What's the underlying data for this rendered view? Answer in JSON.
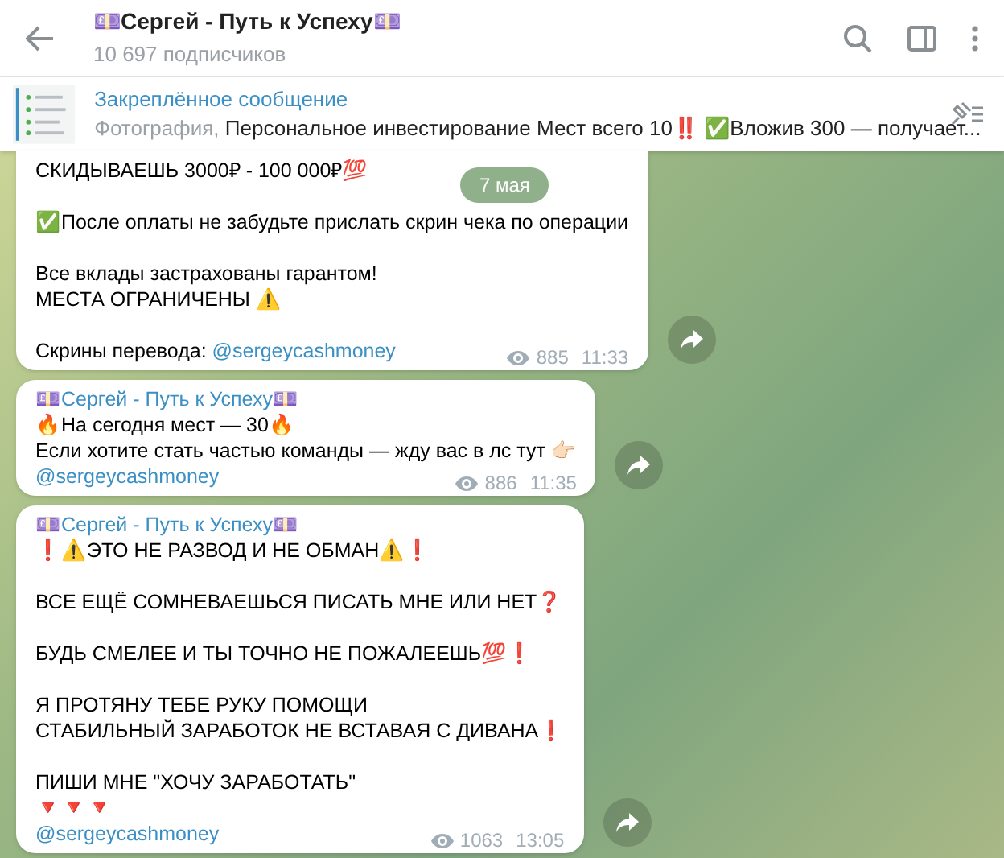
{
  "header": {
    "title": "💷Сергей - Путь к Успеху💷",
    "subtitle": "10 697 подписчиков"
  },
  "pinned": {
    "label": "Закреплённое сообщение",
    "media": "Фотография,",
    "text": "Персональное инвестирование Мест всего 10‼️ ✅Вложив 300 — получает..."
  },
  "date_pill": "7 мая",
  "messages": [
    {
      "paragraphs": [
        [
          "СКИДЫВАЕШЬ 3000₽ - 100 000₽💯"
        ],
        [
          "✅После оплаты не забудьте прислать скрин чека по операции"
        ],
        [
          "Все вклады застрахованы гарантом!",
          "МЕСТА ОГРАНИЧЕНЫ ⚠️"
        ]
      ],
      "link_prefix": "Скрины перевода:",
      "link": "@sergeycashmoney",
      "views": "885",
      "time": "11:33"
    },
    {
      "author": "💷Сергей - Путь к Успеху💷",
      "paragraphs": [
        [
          "🔥На сегодня мест — 30🔥",
          "Если хотите стать частью команды — жду вас в лс тут 👉🏻"
        ]
      ],
      "link": "@sergeycashmoney",
      "views": "886",
      "time": "11:35"
    },
    {
      "author": "💷Сергей - Путь к Успеху💷",
      "paragraphs": [
        [
          "❗️⚠️ЭТО НЕ РАЗВОД И НЕ ОБМАН⚠️❗️"
        ],
        [
          "ВСЕ ЕЩЁ СОМНЕВАЕШЬСЯ ПИСАТЬ МНЕ ИЛИ НЕТ❓"
        ],
        [
          "БУДЬ СМЕЛЕЕ И ТЫ ТОЧНО НЕ ПОЖАЛЕЕШЬ💯❗️"
        ],
        [
          "Я ПРОТЯНУ ТЕБЕ РУКУ ПОМОЩИ",
          "СТАБИЛЬНЫЙ ЗАРАБОТОК НЕ ВСТАВАЯ С ДИВАНА❗️"
        ],
        [
          "ПИШИ МНЕ \"ХОЧУ ЗАРАБОТАТЬ\"",
          "🔻🔻🔻"
        ]
      ],
      "link": "@sergeycashmoney",
      "views": "1063",
      "time": "13:05"
    }
  ]
}
